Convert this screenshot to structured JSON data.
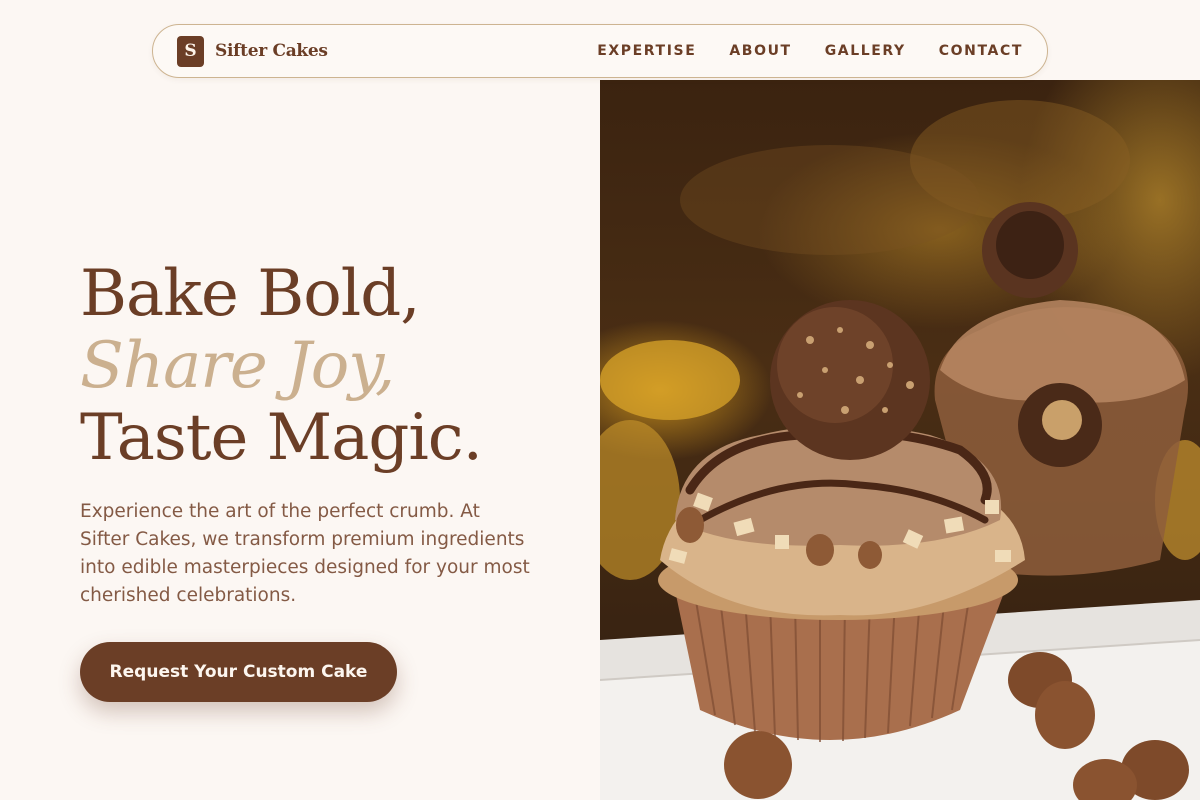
{
  "brand": {
    "logo_letter": "S",
    "name": "Sifter Cakes"
  },
  "nav": {
    "links": [
      {
        "label": "EXPERTISE"
      },
      {
        "label": "ABOUT"
      },
      {
        "label": "GALLERY"
      },
      {
        "label": "CONTACT"
      }
    ]
  },
  "hero": {
    "headline_line1": "Bake Bold,",
    "headline_line2": "Share Joy,",
    "headline_line3": "Taste Magic.",
    "description": "Experience the art of the perfect crumb. At Sifter Cakes, we transform premium ingredients into edible masterpieces designed for your most cherished celebrations.",
    "cta_label": "Request Your Custom Cake"
  },
  "colors": {
    "background": "#fcf7f3",
    "primary_brown": "#6b3e26",
    "accent_tan": "#cbb08f",
    "body_text": "#845a45"
  }
}
